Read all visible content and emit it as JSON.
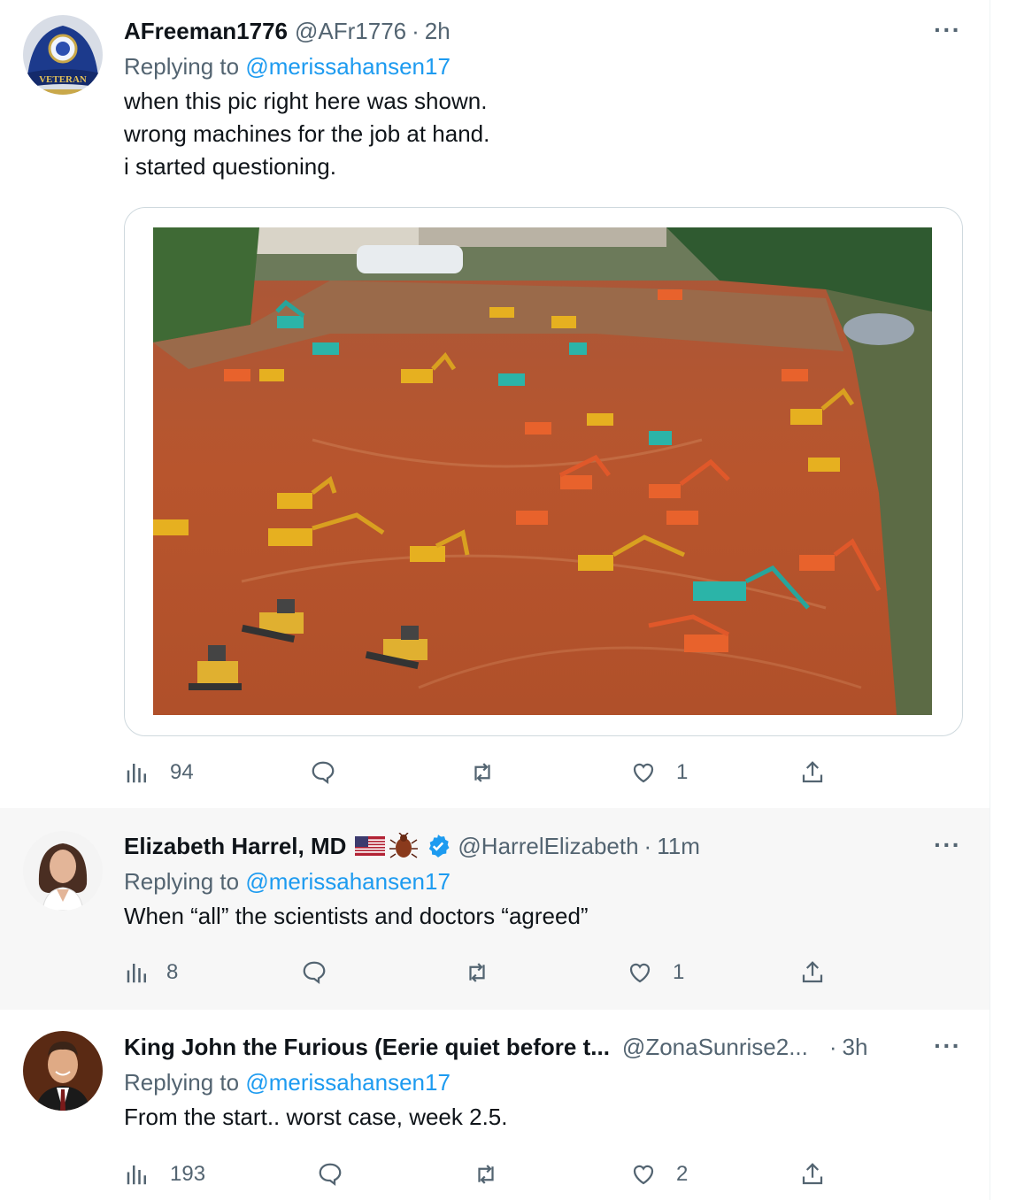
{
  "tweets": [
    {
      "name": "AFreeman1776",
      "handle": "@AFr1776",
      "time": "2h",
      "replying_prefix": "Replying to ",
      "replying_to": "@merissahansen17",
      "lines": [
        "when this pic right here was shown.",
        "wrong machines for the job at hand.",
        "i started questioning."
      ],
      "views": "94",
      "replies": "",
      "retweets": "",
      "likes": "1"
    },
    {
      "name": "Elizabeth Harrel, MD",
      "handle": "@HarrelElizabeth",
      "time": "11m",
      "replying_prefix": "Replying to ",
      "replying_to": "@merissahansen17",
      "lines": [
        "When “all” the scientists and doctors “agreed”"
      ],
      "views": "8",
      "replies": "",
      "retweets": "",
      "likes": "1"
    },
    {
      "name": "King John the Furious (Eerie quiet before t...",
      "handle": "@ZonaSunrise2...",
      "time": "3h",
      "replying_prefix": "Replying to ",
      "replying_to": "@merissahansen17",
      "lines": [
        "From the start.. worst case, week 2.5."
      ],
      "views": "193",
      "replies": "",
      "retweets": "",
      "likes": "2"
    }
  ],
  "dot": "·",
  "more": "···",
  "avatar1_cap_text": "VETERAN",
  "colors": {
    "link": "#1d9bf0",
    "muted": "#536471",
    "text": "#0f1419",
    "verified": "#1d9bf0",
    "dirt": "#b8552d"
  },
  "icons": [
    "views-icon",
    "reply-icon",
    "retweet-icon",
    "like-icon",
    "share-icon",
    "more-icon",
    "verified-icon",
    "us-flag-icon",
    "bug-icon"
  ]
}
